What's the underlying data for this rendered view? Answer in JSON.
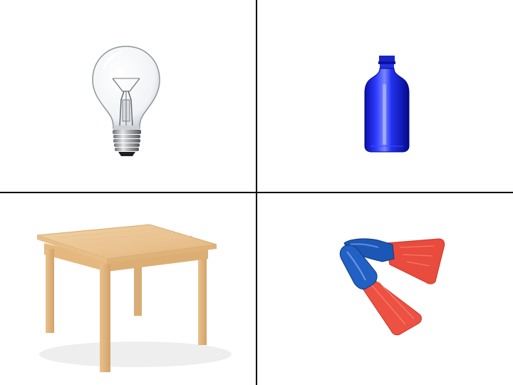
{
  "colors": {
    "background": "#ffffff",
    "divider": "#000000"
  },
  "panels": [
    {
      "icon": "light-bulb-icon"
    },
    {
      "icon": "blue-bottle-icon"
    },
    {
      "icon": "wooden-table-icon"
    },
    {
      "icon": "swim-fins-icon"
    }
  ]
}
